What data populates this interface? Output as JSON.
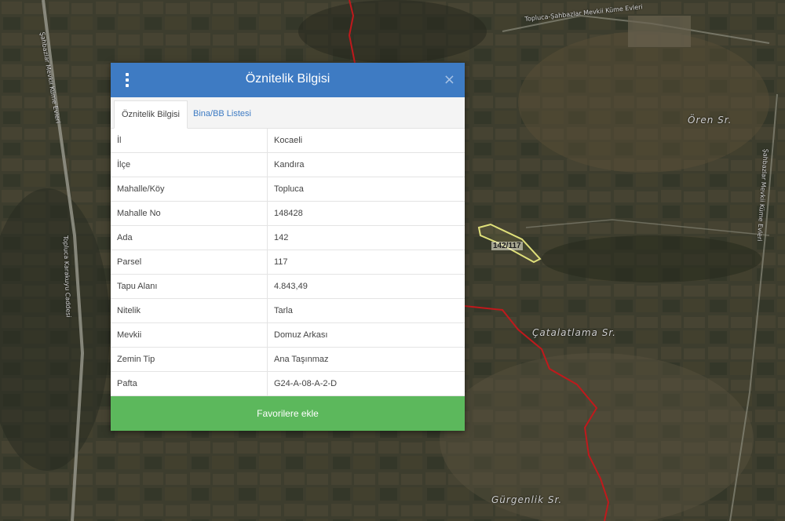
{
  "map": {
    "place_labels": [
      "Ören Sr.",
      "Çatalatlama Sr.",
      "Gürgenlik Sr."
    ],
    "road_labels": [
      "Topluca-Şahbazlar Mevkii Küme Evleri",
      "Şahbazlar Mevkii Küme Evleri",
      "Topluca Karakuyu Caddesi",
      "Şahbazlar Mevkii Küme Evleri"
    ],
    "parcel_label": "142/117",
    "colors": {
      "boundary": "#c0191c",
      "parcel_outline": "#e0e07a"
    }
  },
  "modal": {
    "title": "Öznitelik Bilgisi",
    "close_glyph": "×",
    "tabs": [
      "Öznitelik Bilgisi",
      "Bina/BB Listesi"
    ],
    "rows": [
      {
        "key": "İl",
        "value": "Kocaeli"
      },
      {
        "key": "İlçe",
        "value": "Kandıra"
      },
      {
        "key": "Mahalle/Köy",
        "value": "Topluca"
      },
      {
        "key": "Mahalle No",
        "value": "148428"
      },
      {
        "key": "Ada",
        "value": "142"
      },
      {
        "key": "Parsel",
        "value": "117"
      },
      {
        "key": "Tapu Alanı",
        "value": "4.843,49"
      },
      {
        "key": "Nitelik",
        "value": "Tarla"
      },
      {
        "key": "Mevkii",
        "value": "Domuz Arkası"
      },
      {
        "key": "Zemin Tip",
        "value": "Ana Taşınmaz"
      },
      {
        "key": "Pafta",
        "value": "G24-A-08-A-2-D"
      }
    ],
    "favorite_button": "Favorilere ekle",
    "colors": {
      "header": "#3e7bc3",
      "button": "#5cb85c"
    }
  }
}
